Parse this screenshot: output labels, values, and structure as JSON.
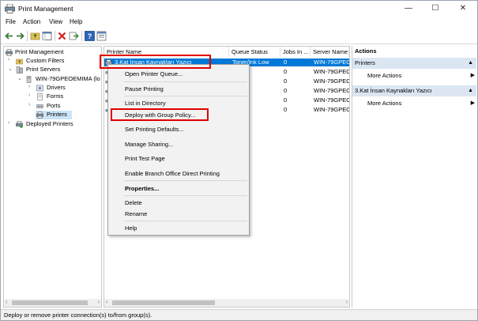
{
  "window": {
    "title": "Print Management",
    "controls": {
      "minimize": "—",
      "maximize": "☐",
      "close": "✕"
    }
  },
  "menubar": {
    "items": [
      "File",
      "Action",
      "View",
      "Help"
    ]
  },
  "toolbar": {
    "icons": [
      "back-arrow-icon",
      "forward-arrow-icon",
      "folder-up-icon",
      "show-hide-tree-icon",
      "delete-icon",
      "export-icon",
      "help-icon",
      "properties-icon"
    ]
  },
  "tree": {
    "root": "Print Management",
    "custom_filters": "Custom Filters",
    "print_servers": "Print Servers",
    "server": "WIN-79GPEOEMIMA (lo",
    "drivers": "Drivers",
    "forms": "Forms",
    "ports": "Ports",
    "printers": "Printers",
    "deployed_printers": "Deployed Printers"
  },
  "list": {
    "columns": [
      "Printer Name",
      "Queue Status",
      "Jobs In ...",
      "Server Name"
    ],
    "rows": [
      {
        "name": "3.Kat İnsan Kaynakları Yazıcı",
        "status": "Toner/Ink Low",
        "jobs": "0",
        "server": "WIN-79GPEO"
      },
      {
        "name": "",
        "status": "",
        "jobs": "0",
        "server": "WIN-79GPEO"
      },
      {
        "name": "",
        "status": "",
        "jobs": "0",
        "server": "WIN-79GPEO"
      },
      {
        "name": "",
        "status": "",
        "jobs": "0",
        "server": "WIN-79GPEO"
      },
      {
        "name": "",
        "status": "",
        "jobs": "0",
        "server": "WIN-79GPEO"
      },
      {
        "name": "",
        "status": "",
        "jobs": "0",
        "server": "WIN-79GPEO"
      }
    ]
  },
  "context_menu": {
    "open_queue": "Open Printer Queue...",
    "pause": "Pause Printing",
    "list_in_directory": "List in Directory",
    "deploy_gpo": "Deploy with Group Policy...",
    "set_defaults": "Set Printing Defaults...",
    "manage_sharing": "Manage Sharing...",
    "test_page": "Print Test Page",
    "branch_office": "Enable Branch Office Direct Printing",
    "properties": "Properties...",
    "delete": "Delete",
    "rename": "Rename",
    "help": "Help"
  },
  "actions": {
    "header": "Actions",
    "section1": "Printers",
    "section1_more": "More Actions",
    "section2": "3.Kat İnsan Kaynakları Yazıcı",
    "section2_more": "More Actions"
  },
  "status": {
    "text": "Deploy or remove printer connection(s) to/from group(s)."
  },
  "colors": {
    "selection": "#0078d7",
    "highlight_box": "#e00000",
    "actions_section": "#dbe6f2"
  }
}
